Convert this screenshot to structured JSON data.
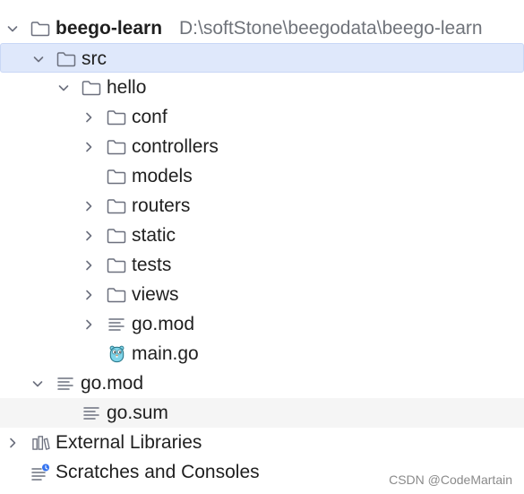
{
  "tree": {
    "root": {
      "name": "beego-learn",
      "path": "D:\\softStone\\beegodata\\beego-learn"
    },
    "src": {
      "name": "src"
    },
    "hello": {
      "name": "hello"
    },
    "hello_children": [
      {
        "name": "conf"
      },
      {
        "name": "controllers"
      },
      {
        "name": "models"
      },
      {
        "name": "routers"
      },
      {
        "name": "static"
      },
      {
        "name": "tests"
      },
      {
        "name": "views"
      },
      {
        "name": "go.mod"
      },
      {
        "name": "main.go"
      }
    ],
    "root_files": [
      {
        "name": "go.mod"
      },
      {
        "name": "go.sum"
      }
    ],
    "external_libraries": {
      "name": "External Libraries"
    },
    "scratches": {
      "name": "Scratches and Consoles"
    }
  },
  "watermark": "CSDN @CodeMartain",
  "colors": {
    "selection": "#dfe8fb",
    "hover": "#f5f5f5",
    "text": "#1f1f1f",
    "path": "#6f737a",
    "icon": "#6c707e",
    "gopher": "#7fd5ea",
    "badge": "#3574f0"
  }
}
